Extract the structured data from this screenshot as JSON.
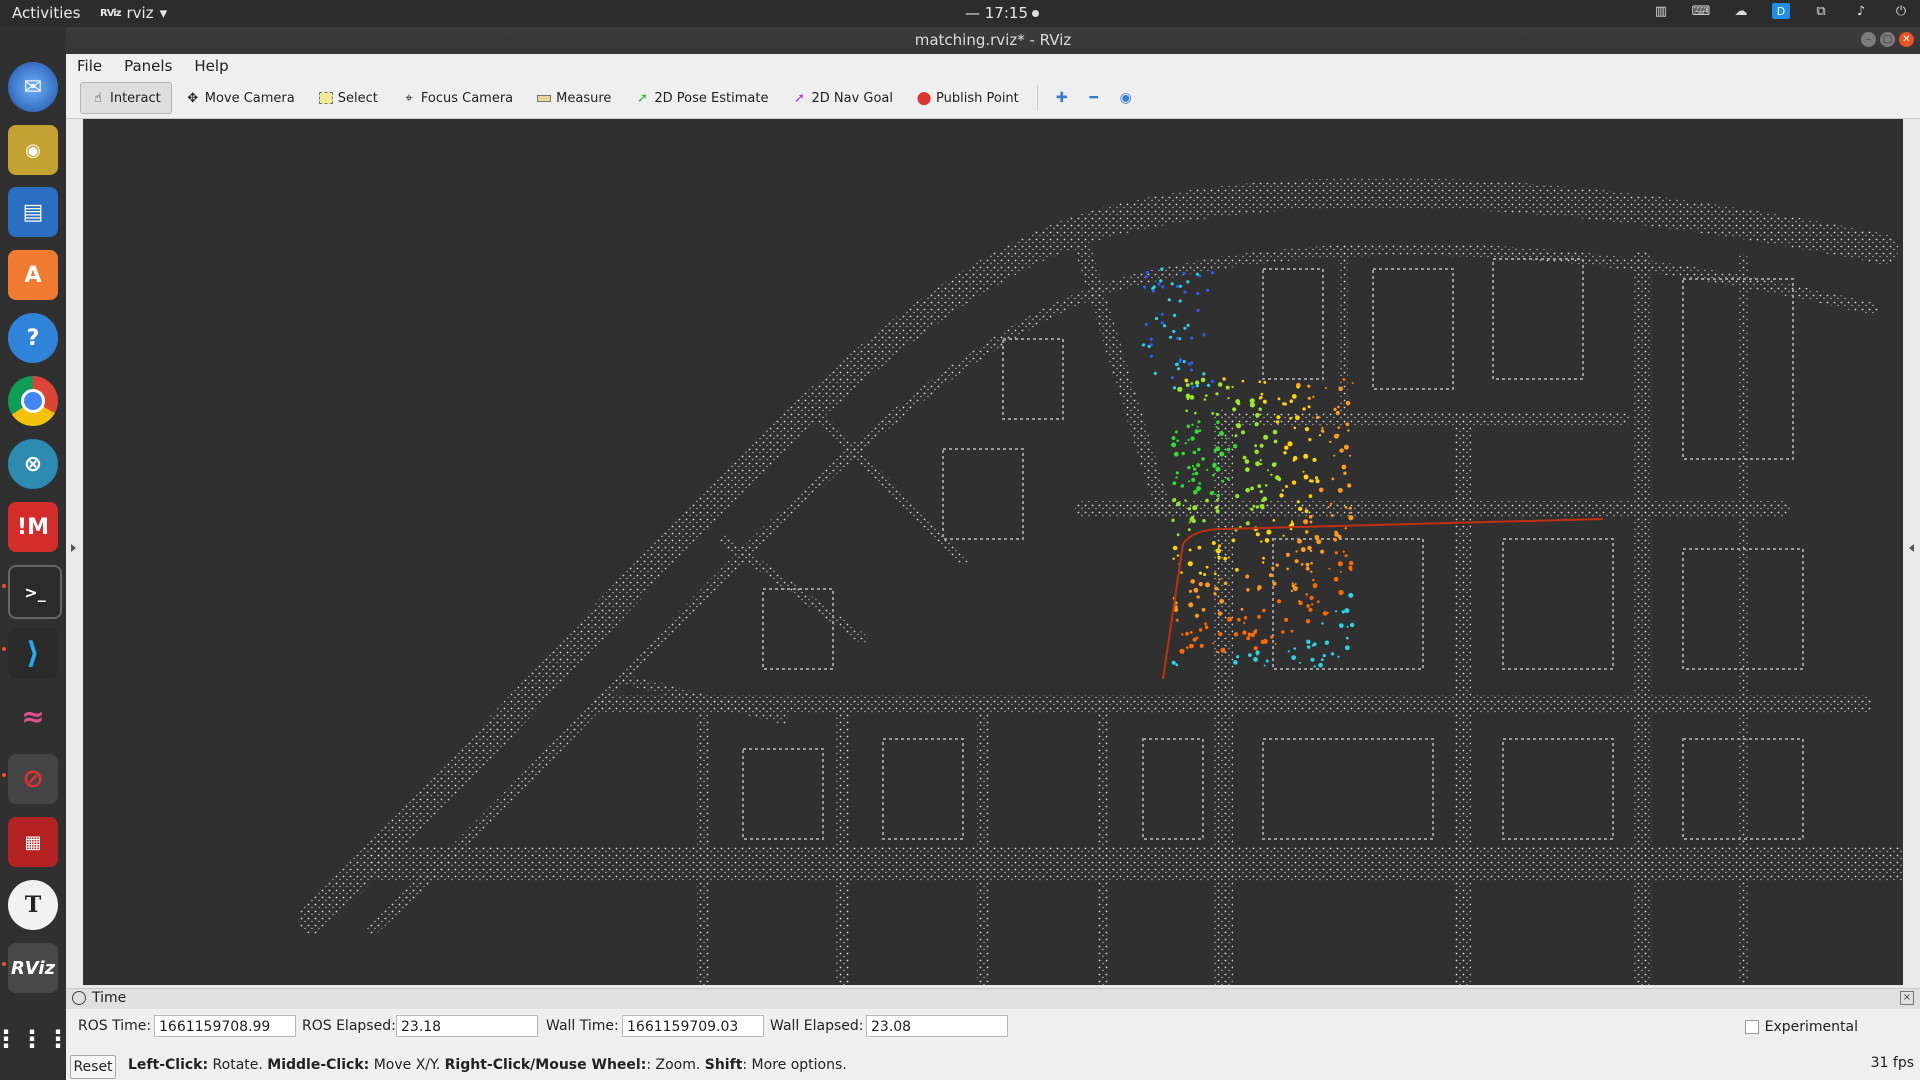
{
  "topbar": {
    "activities": "Activities",
    "app_icon_text": "RViz",
    "app_name": "rviz",
    "clock": "— 17:15",
    "tray_icons": [
      "window-list-icon",
      "keyboard-icon",
      "cloud-icon",
      "dropbox-icon",
      "network-icon",
      "volume-icon",
      "power-icon"
    ]
  },
  "dock": {
    "items": [
      "thunderbird-icon",
      "rhythmbox-icon",
      "writer-icon",
      "software-center-icon",
      "help-icon",
      "chrome-icon",
      "crossover-icon",
      "meld-icon",
      "terminal-icon",
      "vscode-icon",
      "kdenlive-icon",
      "blocked-app-icon",
      "red-game-icon",
      "typora-icon",
      "rviz-icon",
      "show-apps-icon"
    ],
    "rviz_label": "RViz"
  },
  "window": {
    "title": "matching.rviz* - RViz"
  },
  "menu": [
    "File",
    "Panels",
    "Help"
  ],
  "toolbar": {
    "interact": "Interact",
    "move_camera": "Move Camera",
    "select": "Select",
    "focus_camera": "Focus Camera",
    "measure": "Measure",
    "pose_estimate": "2D Pose Estimate",
    "nav_goal": "2D Nav Goal",
    "publish_point": "Publish Point"
  },
  "time_panel": {
    "title": "Time",
    "ros_time_label": "ROS Time:",
    "ros_time": "1661159708.99",
    "ros_elapsed_label": "ROS Elapsed:",
    "ros_elapsed": "23.18",
    "wall_time_label": "Wall Time:",
    "wall_time": "1661159709.03",
    "wall_elapsed_label": "Wall Elapsed:",
    "wall_elapsed": "23.08",
    "experimental": "Experimental"
  },
  "status": {
    "reset": "Reset",
    "hint_left_click": "Left-Click:",
    "hint_rotate": " Rotate. ",
    "hint_middle_click": "Middle-Click:",
    "hint_move": " Move X/Y. ",
    "hint_right_click": "Right-Click/Mouse Wheel:",
    "hint_zoom": ": Zoom. ",
    "hint_shift": "Shift",
    "hint_more": ": More options.",
    "fps": "31 fps"
  },
  "colors": {
    "accent": "#e95420",
    "viewport_bg": "#303030",
    "cloud": "#d8d8d8",
    "path": "#c03010"
  }
}
